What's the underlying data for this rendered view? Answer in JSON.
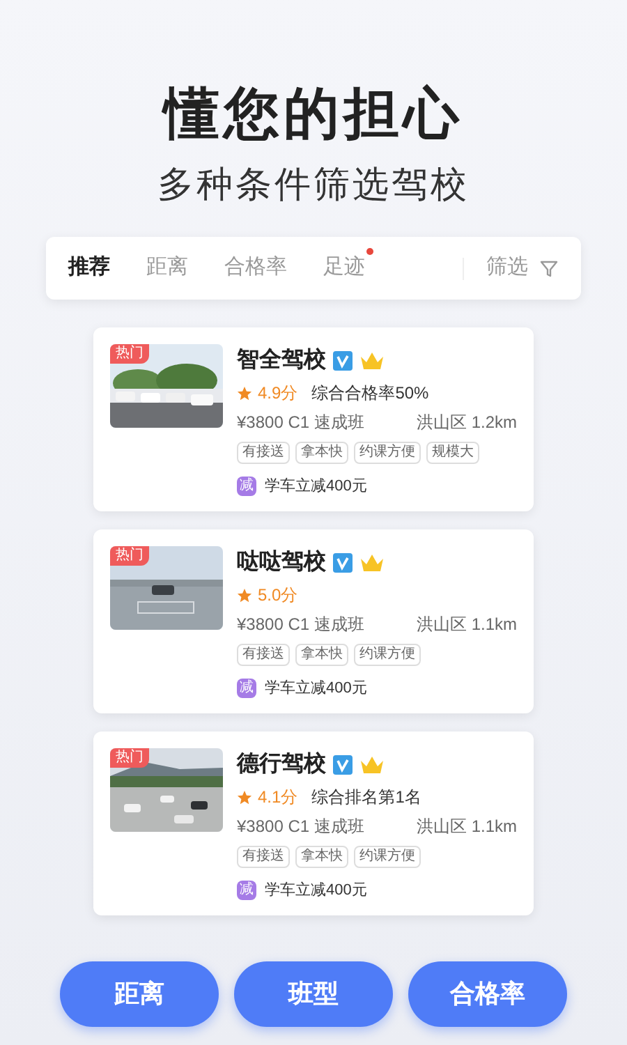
{
  "headline": "懂您的担心",
  "subheadline": "多种条件筛选驾校",
  "tabs": [
    {
      "label": "推荐",
      "selected": true,
      "dot": false
    },
    {
      "label": "距离",
      "selected": false,
      "dot": false
    },
    {
      "label": "合格率",
      "selected": false,
      "dot": false
    },
    {
      "label": "足迹",
      "selected": false,
      "dot": true
    }
  ],
  "filter": {
    "label": "筛选"
  },
  "schools": [
    {
      "name": "智全驾校",
      "badge": "热门",
      "rating": "4.9分",
      "highlight": "综合合格率50%",
      "price": "¥3800 C1 速成班",
      "location": "洪山区 1.2km",
      "tags": [
        "有接送",
        "拿本快",
        "约课方便",
        "规模大"
      ],
      "promo_mark": "减",
      "promo": "学车立减400元"
    },
    {
      "name": "哒哒驾校",
      "badge": "热门",
      "rating": "5.0分",
      "price": "¥3800 C1 速成班",
      "location": "洪山区 1.1km",
      "tags": [
        "有接送",
        "拿本快",
        "约课方便"
      ],
      "promo_mark": "减",
      "promo": "学车立减400元"
    },
    {
      "name": "德行驾校",
      "badge": "热门",
      "rating": "4.1分",
      "highlight": "综合排名第1名",
      "price": "¥3800 C1 速成班",
      "location": "洪山区 1.1km",
      "tags": [
        "有接送",
        "拿本快",
        "约课方便"
      ],
      "promo_mark": "减",
      "promo": "学车立减400元"
    }
  ],
  "bottom_buttons": [
    "距离",
    "班型",
    "合格率"
  ]
}
